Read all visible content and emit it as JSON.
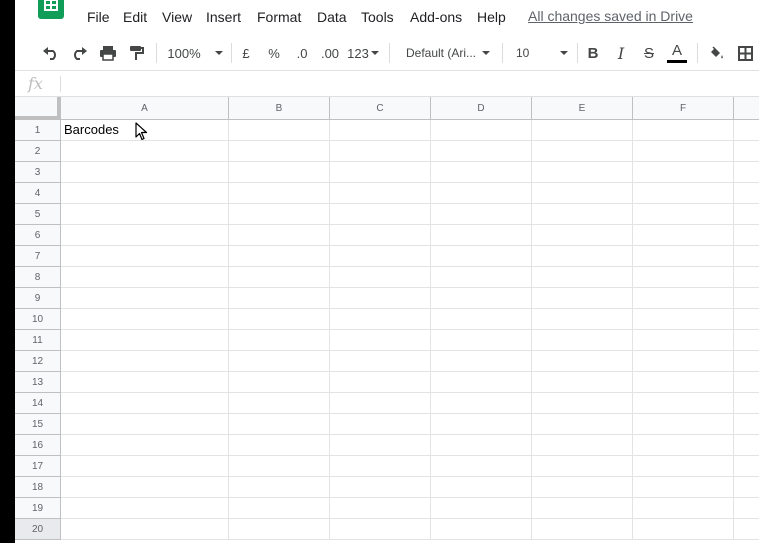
{
  "menu": {
    "items": [
      "File",
      "Edit",
      "View",
      "Insert",
      "Format",
      "Data",
      "Tools",
      "Add-ons",
      "Help"
    ],
    "save_status": "All changes saved in Drive"
  },
  "toolbar": {
    "zoom": "100%",
    "currency": "£",
    "percent": "%",
    "decrease_decimals": ".0",
    "increase_decimals": ".00",
    "more_formats": "123",
    "font": "Default (Ari...",
    "font_size": "10",
    "text_color_hex": "#000000",
    "bold_label": "B",
    "italic_label": "I",
    "strike_label": "S",
    "text_color_label": "A"
  },
  "formula_bar": {
    "fx_label": "fx",
    "value": ""
  },
  "sheet": {
    "columns": [
      "A",
      "B",
      "C",
      "D",
      "E",
      "F"
    ],
    "rows": [
      "1",
      "2",
      "3",
      "4",
      "5",
      "6",
      "7",
      "8",
      "9",
      "10",
      "11",
      "12",
      "13",
      "14",
      "15",
      "16",
      "17",
      "18",
      "19",
      "20"
    ],
    "cells": {
      "A1": "Barcodes"
    }
  },
  "colors": {
    "brand": "#0f9d58",
    "header_bg": "#f8f9fa",
    "gridline": "#e2e3e3"
  }
}
